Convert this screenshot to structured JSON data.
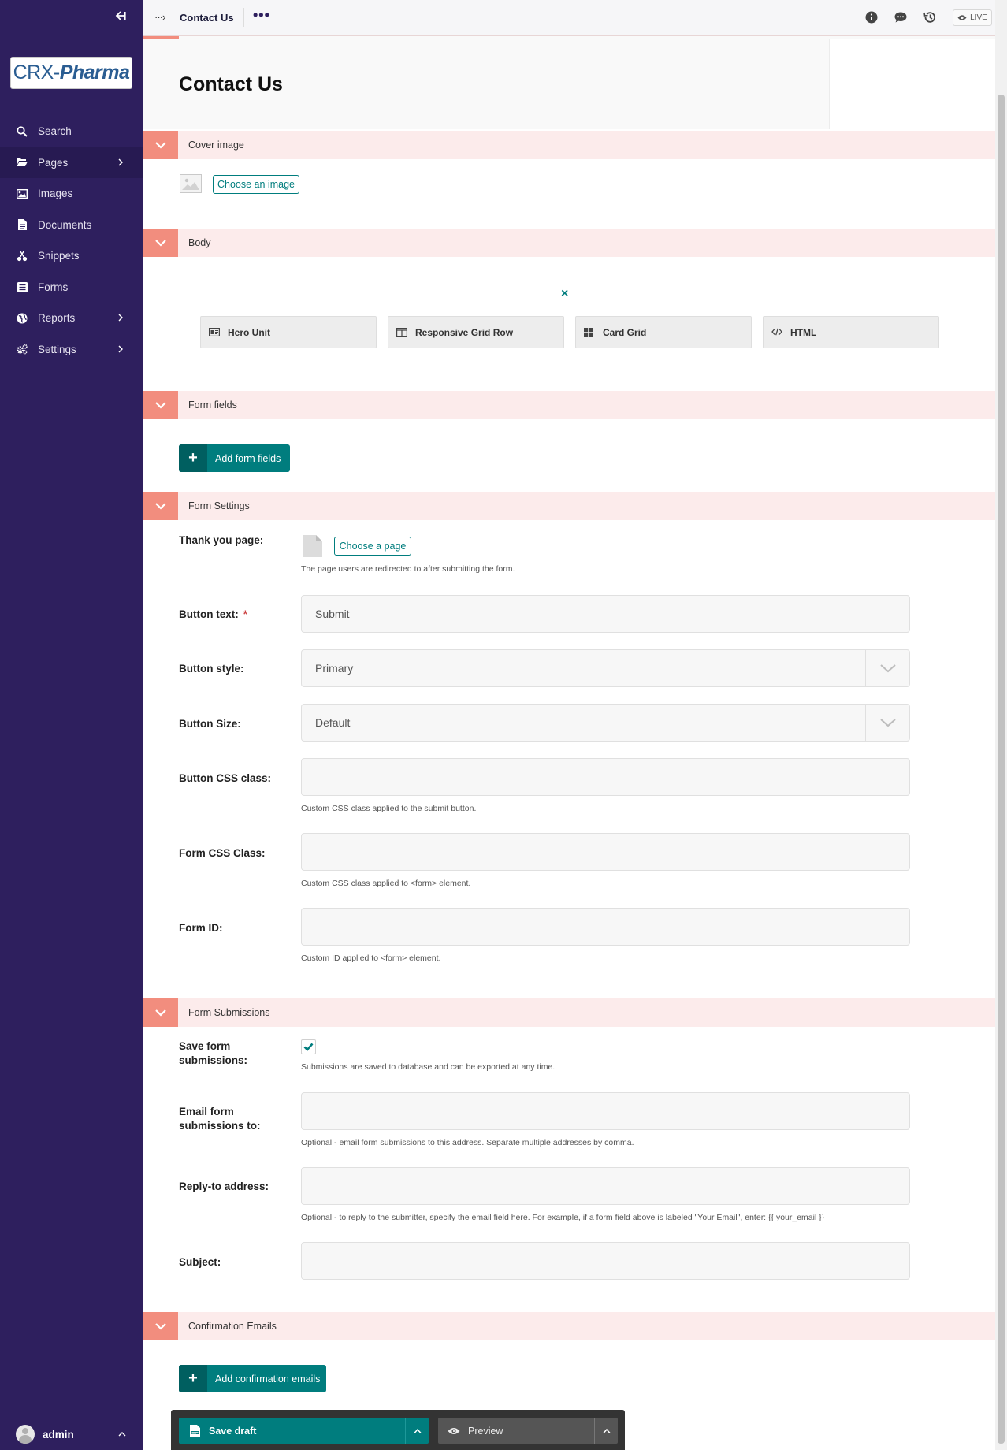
{
  "sidebar": {
    "logo": {
      "brand": "CRX-",
      "brand_italic": "Pharma"
    },
    "items": [
      {
        "label": "Search",
        "icon": "search-icon"
      },
      {
        "label": "Pages",
        "icon": "folder-open-icon"
      },
      {
        "label": "Images",
        "icon": "image-icon"
      },
      {
        "label": "Documents",
        "icon": "document-icon"
      },
      {
        "label": "Snippets",
        "icon": "snippet-icon"
      },
      {
        "label": "Forms",
        "icon": "form-icon"
      },
      {
        "label": "Reports",
        "icon": "globe-icon"
      },
      {
        "label": "Settings",
        "icon": "cogs-icon"
      }
    ],
    "user": {
      "name": "admin"
    }
  },
  "header": {
    "breadcrumb_arrow": "···›",
    "page": "Contact Us",
    "more": "•••",
    "live": "LIVE"
  },
  "page": {
    "title": "Contact Us"
  },
  "sections": {
    "cover": {
      "title": "Cover image",
      "choose": "Choose an image"
    },
    "body": {
      "title": "Body",
      "close": "×",
      "blocks": [
        "Hero Unit",
        "Responsive Grid Row",
        "Card Grid",
        "HTML"
      ]
    },
    "form_fields": {
      "title": "Form fields",
      "add": "Add form fields",
      "plus": "+"
    },
    "form_settings": {
      "title": "Form Settings",
      "thank_you_label": "Thank you page:",
      "choose_page": "Choose a page",
      "thank_you_help": "The page users are redirected to after submitting the form.",
      "button_text_label": "Button text:",
      "required": "*",
      "button_text_value": "Submit",
      "button_style_label": "Button style:",
      "button_style_value": "Primary",
      "button_size_label": "Button Size:",
      "button_size_value": "Default",
      "button_css_label": "Button CSS class:",
      "button_css_help": "Custom CSS class applied to the submit button.",
      "form_css_label": "Form CSS Class:",
      "form_css_help": "Custom CSS class applied to <form> element.",
      "form_id_label": "Form ID:",
      "form_id_help": "Custom ID applied to <form> element."
    },
    "form_submissions": {
      "title": "Form Submissions",
      "save_label_1": "Save form",
      "save_label_2": "submissions:",
      "save_help": "Submissions are saved to database and can be exported at any time.",
      "email_label_1": "Email form",
      "email_label_2": "submissions to:",
      "email_help": "Optional - email form submissions to this address. Separate multiple addresses by comma.",
      "reply_label": "Reply-to address:",
      "reply_help": "Optional - to reply to the submitter, specify the email field here. For example, if a form field above is labeled \"Your Email\", enter: {{ your_email }}",
      "subject_label": "Subject:"
    },
    "confirmation": {
      "title": "Confirmation Emails",
      "add": "Add confirmation emails",
      "plus": "+"
    }
  },
  "actions": {
    "save": "Save draft",
    "preview": "Preview"
  },
  "colors": {
    "sidebar": "#2e1f5e",
    "accent": "#007d7e",
    "section_toggle": "#f28d7e",
    "section_bg": "#fcebeb"
  }
}
